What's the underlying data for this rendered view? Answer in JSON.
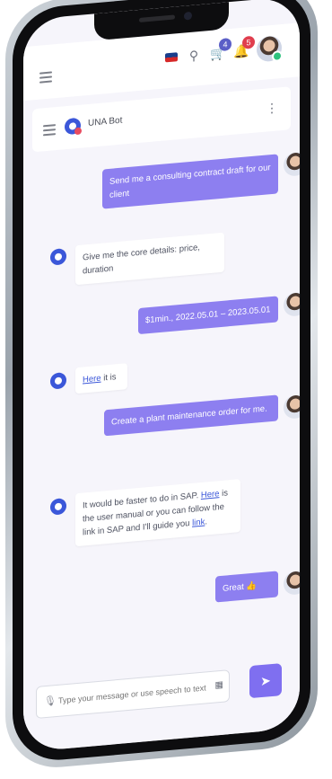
{
  "header": {
    "notifications": {
      "cart_count": "4",
      "bell_count": "5"
    }
  },
  "chat": {
    "title": "UNA Bot"
  },
  "messages": [
    {
      "from": "user",
      "text": "Send me a consulting contract draft for our client"
    },
    {
      "from": "bot",
      "text": "Give me the core details: price, duration"
    },
    {
      "from": "user",
      "text": "$1min., 2022.05.01 – 2023.05.01"
    },
    {
      "from": "bot",
      "link": "Here",
      "text_after": " it is"
    },
    {
      "from": "user",
      "text": "Create a plant maintenance order for me."
    },
    {
      "from": "bot",
      "text_before": "It would be faster to do in SAP. ",
      "link1": "Here",
      "text_mid": " is the user manual or you can follow the link in SAP and I'll guide you ",
      "link2": "link",
      "text_end": "."
    },
    {
      "from": "user",
      "text": "Great 👍"
    }
  ],
  "composer": {
    "placeholder": "Type your message or use speech to text"
  },
  "icons": {
    "menu": "hamburger-icon",
    "search": "search-icon",
    "cart": "cart-icon",
    "bell": "bell-icon",
    "more": "kebab-icon",
    "mic": "mic-icon",
    "attach": "attach-icon",
    "send": "send-icon"
  },
  "colors": {
    "accent": "#8d7ff0",
    "bot_logo": "#3b57d9",
    "badge_blue": "#5b5fc7",
    "badge_red": "#e03e4e"
  }
}
